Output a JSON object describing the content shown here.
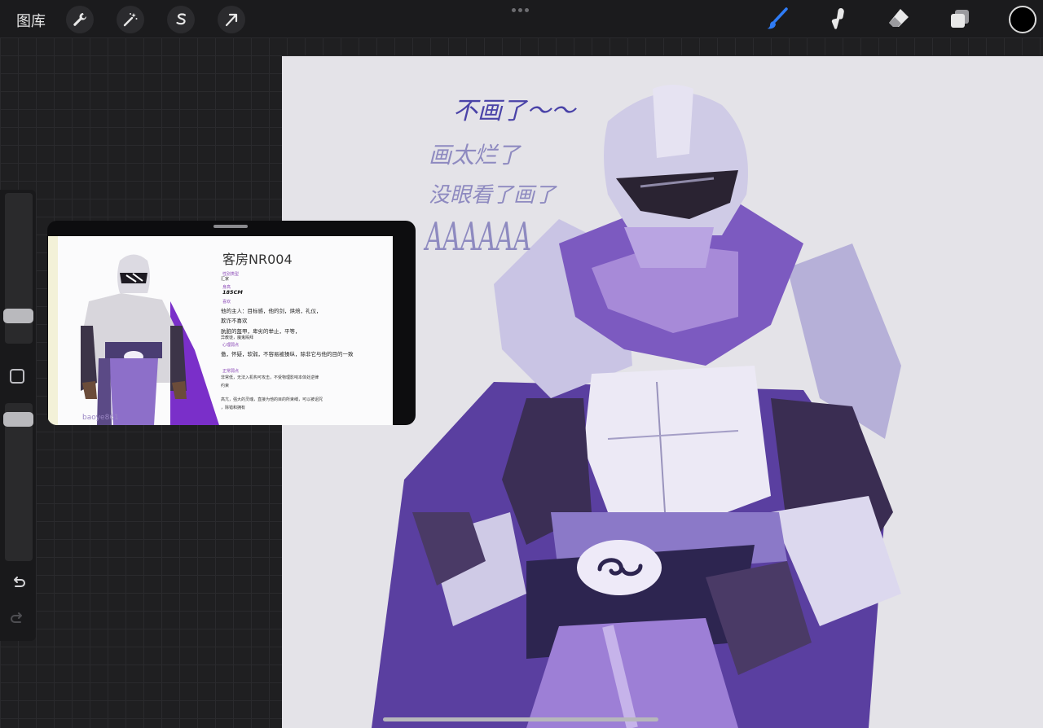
{
  "toolbar": {
    "gallery_label": "图库",
    "left_icons": [
      "wrench-icon",
      "magic-wand-icon",
      "selection-s-icon",
      "transform-arrow-icon"
    ],
    "right_tools": [
      "brush-icon",
      "smudge-icon",
      "eraser-icon",
      "layers-icon"
    ],
    "active_tool": "brush-icon",
    "current_color": "#000000",
    "accent_color": "#2f7cf6"
  },
  "reference": {
    "title": "客房NR004",
    "field1_label": "性别类型",
    "field1_value": "汇家",
    "height_label": "身高",
    "height_value": "185CM",
    "likes_label": "喜欢",
    "likes_line1": "他的主人：目标感，他的剑，烘焙，礼仪，",
    "likes_line2": "欺诈不喜欢",
    "likes_line3": "肮脏的盔甲，卑劣的举止，平等，",
    "likes_line4": "异教徒，魔鬼殿拜",
    "weak_label": "心理弱点",
    "weak_line": "傲，怀疑，软弱，不容易被操纵，除非它与他的目的一致",
    "normal_label": "正常弱点",
    "normal_line1": "非常低，无法入机构可攻击，不受物理影响本体处逆律",
    "normal_line2": "约束",
    "desc_line1": "高亢，强大的灵魂，直接为他的目的所束缚，可以被诅咒",
    "desc_line2": "，除错和拥有",
    "watermark": "baoye861"
  },
  "notes": [
    "不画了～～",
    "画太烂了",
    "没眼看了画了",
    "AAAAAA"
  ]
}
